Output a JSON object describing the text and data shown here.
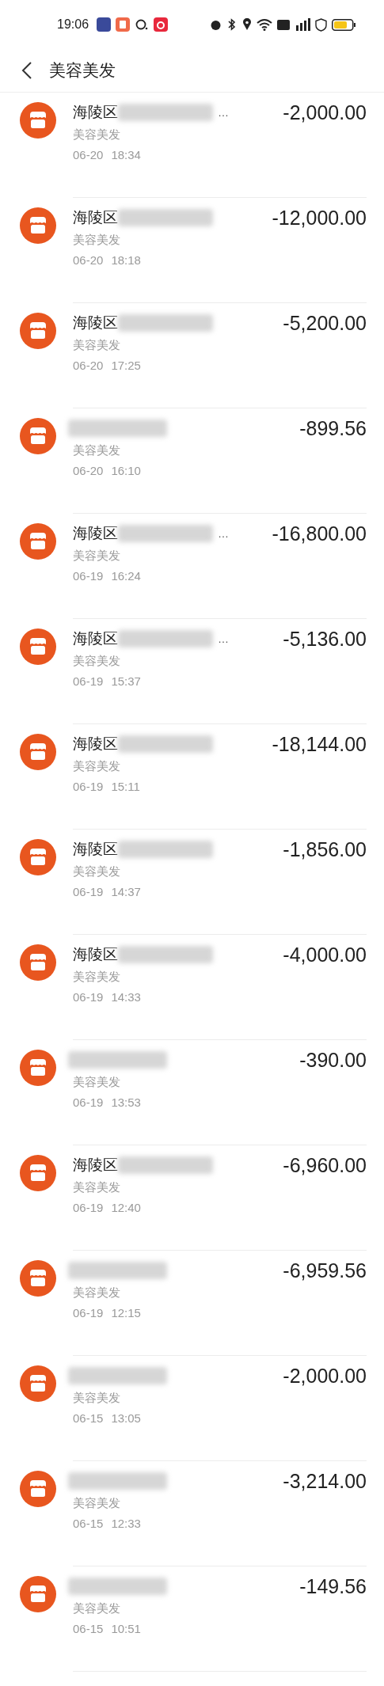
{
  "status_bar": {
    "time": "19:06"
  },
  "header": {
    "title": "美容美发"
  },
  "transactions": [
    {
      "merchant": "海陵区",
      "ellipsis": "…",
      "category": "美容美发",
      "date": "06-20",
      "time": "18:34",
      "amount": "-2,000.00"
    },
    {
      "merchant": "海陵区",
      "category": "美容美发",
      "date": "06-20",
      "time": "18:18",
      "amount": "-12,000.00"
    },
    {
      "merchant": "海陵区",
      "category": "美容美发",
      "date": "06-20",
      "time": "17:25",
      "amount": "-5,200.00"
    },
    {
      "category": "美容美发",
      "date": "06-20",
      "time": "16:10",
      "amount": "-899.56"
    },
    {
      "merchant": "海陵区",
      "ellipsis": "…",
      "category": "美容美发",
      "date": "06-19",
      "time": "16:24",
      "amount": "-16,800.00"
    },
    {
      "merchant": "海陵区",
      "ellipsis": "…",
      "category": "美容美发",
      "date": "06-19",
      "time": "15:37",
      "amount": "-5,136.00"
    },
    {
      "merchant": "海陵区",
      "category": "美容美发",
      "date": "06-19",
      "time": "15:11",
      "amount": "-18,144.00"
    },
    {
      "merchant": "海陵区",
      "category": "美容美发",
      "date": "06-19",
      "time": "14:37",
      "amount": "-1,856.00"
    },
    {
      "merchant": "海陵区",
      "category": "美容美发",
      "date": "06-19",
      "time": "14:33",
      "amount": "-4,000.00"
    },
    {
      "category": "美容美发",
      "date": "06-19",
      "time": "13:53",
      "amount": "-390.00"
    },
    {
      "merchant": "海陵区",
      "category": "美容美发",
      "date": "06-19",
      "time": "12:40",
      "amount": "-6,960.00"
    },
    {
      "category": "美容美发",
      "date": "06-19",
      "time": "12:15",
      "amount": "-6,959.56"
    },
    {
      "category": "美容美发",
      "date": "06-15",
      "time": "13:05",
      "amount": "-2,000.00"
    },
    {
      "category": "美容美发",
      "date": "06-15",
      "time": "12:33",
      "amount": "-3,214.00"
    },
    {
      "category": "美容美发",
      "date": "06-15",
      "time": "10:51",
      "amount": "-149.56"
    }
  ]
}
